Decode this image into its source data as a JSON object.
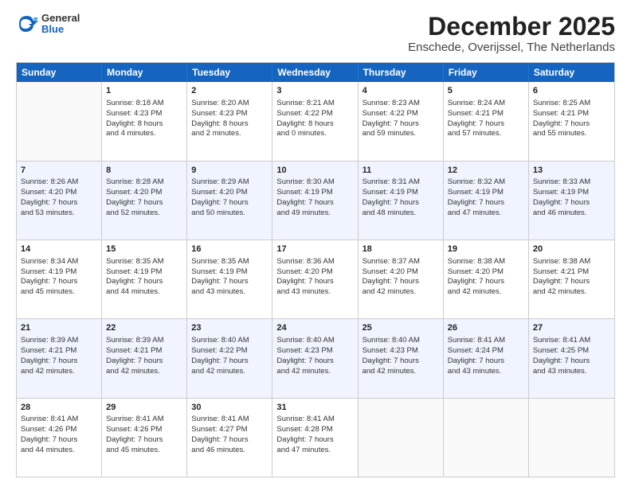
{
  "logo": {
    "general": "General",
    "blue": "Blue"
  },
  "title": {
    "month": "December 2025",
    "location": "Enschede, Overijssel, The Netherlands"
  },
  "header_days": [
    "Sunday",
    "Monday",
    "Tuesday",
    "Wednesday",
    "Thursday",
    "Friday",
    "Saturday"
  ],
  "weeks": [
    [
      {
        "day": "",
        "lines": []
      },
      {
        "day": "1",
        "lines": [
          "Sunrise: 8:18 AM",
          "Sunset: 4:23 PM",
          "Daylight: 8 hours",
          "and 4 minutes."
        ]
      },
      {
        "day": "2",
        "lines": [
          "Sunrise: 8:20 AM",
          "Sunset: 4:23 PM",
          "Daylight: 8 hours",
          "and 2 minutes."
        ]
      },
      {
        "day": "3",
        "lines": [
          "Sunrise: 8:21 AM",
          "Sunset: 4:22 PM",
          "Daylight: 8 hours",
          "and 0 minutes."
        ]
      },
      {
        "day": "4",
        "lines": [
          "Sunrise: 8:23 AM",
          "Sunset: 4:22 PM",
          "Daylight: 7 hours",
          "and 59 minutes."
        ]
      },
      {
        "day": "5",
        "lines": [
          "Sunrise: 8:24 AM",
          "Sunset: 4:21 PM",
          "Daylight: 7 hours",
          "and 57 minutes."
        ]
      },
      {
        "day": "6",
        "lines": [
          "Sunrise: 8:25 AM",
          "Sunset: 4:21 PM",
          "Daylight: 7 hours",
          "and 55 minutes."
        ]
      }
    ],
    [
      {
        "day": "7",
        "lines": [
          "Sunrise: 8:26 AM",
          "Sunset: 4:20 PM",
          "Daylight: 7 hours",
          "and 53 minutes."
        ]
      },
      {
        "day": "8",
        "lines": [
          "Sunrise: 8:28 AM",
          "Sunset: 4:20 PM",
          "Daylight: 7 hours",
          "and 52 minutes."
        ]
      },
      {
        "day": "9",
        "lines": [
          "Sunrise: 8:29 AM",
          "Sunset: 4:20 PM",
          "Daylight: 7 hours",
          "and 50 minutes."
        ]
      },
      {
        "day": "10",
        "lines": [
          "Sunrise: 8:30 AM",
          "Sunset: 4:19 PM",
          "Daylight: 7 hours",
          "and 49 minutes."
        ]
      },
      {
        "day": "11",
        "lines": [
          "Sunrise: 8:31 AM",
          "Sunset: 4:19 PM",
          "Daylight: 7 hours",
          "and 48 minutes."
        ]
      },
      {
        "day": "12",
        "lines": [
          "Sunrise: 8:32 AM",
          "Sunset: 4:19 PM",
          "Daylight: 7 hours",
          "and 47 minutes."
        ]
      },
      {
        "day": "13",
        "lines": [
          "Sunrise: 8:33 AM",
          "Sunset: 4:19 PM",
          "Daylight: 7 hours",
          "and 46 minutes."
        ]
      }
    ],
    [
      {
        "day": "14",
        "lines": [
          "Sunrise: 8:34 AM",
          "Sunset: 4:19 PM",
          "Daylight: 7 hours",
          "and 45 minutes."
        ]
      },
      {
        "day": "15",
        "lines": [
          "Sunrise: 8:35 AM",
          "Sunset: 4:19 PM",
          "Daylight: 7 hours",
          "and 44 minutes."
        ]
      },
      {
        "day": "16",
        "lines": [
          "Sunrise: 8:35 AM",
          "Sunset: 4:19 PM",
          "Daylight: 7 hours",
          "and 43 minutes."
        ]
      },
      {
        "day": "17",
        "lines": [
          "Sunrise: 8:36 AM",
          "Sunset: 4:20 PM",
          "Daylight: 7 hours",
          "and 43 minutes."
        ]
      },
      {
        "day": "18",
        "lines": [
          "Sunrise: 8:37 AM",
          "Sunset: 4:20 PM",
          "Daylight: 7 hours",
          "and 42 minutes."
        ]
      },
      {
        "day": "19",
        "lines": [
          "Sunrise: 8:38 AM",
          "Sunset: 4:20 PM",
          "Daylight: 7 hours",
          "and 42 minutes."
        ]
      },
      {
        "day": "20",
        "lines": [
          "Sunrise: 8:38 AM",
          "Sunset: 4:21 PM",
          "Daylight: 7 hours",
          "and 42 minutes."
        ]
      }
    ],
    [
      {
        "day": "21",
        "lines": [
          "Sunrise: 8:39 AM",
          "Sunset: 4:21 PM",
          "Daylight: 7 hours",
          "and 42 minutes."
        ]
      },
      {
        "day": "22",
        "lines": [
          "Sunrise: 8:39 AM",
          "Sunset: 4:21 PM",
          "Daylight: 7 hours",
          "and 42 minutes."
        ]
      },
      {
        "day": "23",
        "lines": [
          "Sunrise: 8:40 AM",
          "Sunset: 4:22 PM",
          "Daylight: 7 hours",
          "and 42 minutes."
        ]
      },
      {
        "day": "24",
        "lines": [
          "Sunrise: 8:40 AM",
          "Sunset: 4:23 PM",
          "Daylight: 7 hours",
          "and 42 minutes."
        ]
      },
      {
        "day": "25",
        "lines": [
          "Sunrise: 8:40 AM",
          "Sunset: 4:23 PM",
          "Daylight: 7 hours",
          "and 42 minutes."
        ]
      },
      {
        "day": "26",
        "lines": [
          "Sunrise: 8:41 AM",
          "Sunset: 4:24 PM",
          "Daylight: 7 hours",
          "and 43 minutes."
        ]
      },
      {
        "day": "27",
        "lines": [
          "Sunrise: 8:41 AM",
          "Sunset: 4:25 PM",
          "Daylight: 7 hours",
          "and 43 minutes."
        ]
      }
    ],
    [
      {
        "day": "28",
        "lines": [
          "Sunrise: 8:41 AM",
          "Sunset: 4:26 PM",
          "Daylight: 7 hours",
          "and 44 minutes."
        ]
      },
      {
        "day": "29",
        "lines": [
          "Sunrise: 8:41 AM",
          "Sunset: 4:26 PM",
          "Daylight: 7 hours",
          "and 45 minutes."
        ]
      },
      {
        "day": "30",
        "lines": [
          "Sunrise: 8:41 AM",
          "Sunset: 4:27 PM",
          "Daylight: 7 hours",
          "and 46 minutes."
        ]
      },
      {
        "day": "31",
        "lines": [
          "Sunrise: 8:41 AM",
          "Sunset: 4:28 PM",
          "Daylight: 7 hours",
          "and 47 minutes."
        ]
      },
      {
        "day": "",
        "lines": []
      },
      {
        "day": "",
        "lines": []
      },
      {
        "day": "",
        "lines": []
      }
    ]
  ]
}
